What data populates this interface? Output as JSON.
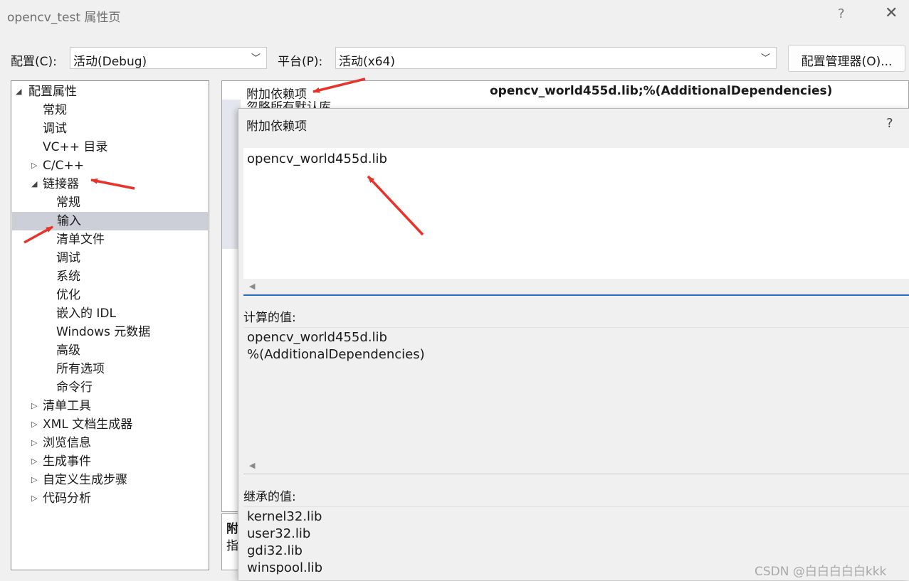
{
  "window": {
    "title": "opencv_test 属性页",
    "help_label": "?",
    "close_label": "✕"
  },
  "config_bar": {
    "config_label": "配置(C):",
    "config_value": "活动(Debug)",
    "platform_label": "平台(P):",
    "platform_value": "活动(x64)",
    "config_manager_button": "配置管理器(O)..."
  },
  "tree": {
    "items": [
      {
        "label": "配置属性",
        "toggle": "◢",
        "level": 0,
        "selected": false
      },
      {
        "label": "常规",
        "toggle": "",
        "level": 1,
        "selected": false
      },
      {
        "label": "调试",
        "toggle": "",
        "level": 1,
        "selected": false
      },
      {
        "label": "VC++ 目录",
        "toggle": "",
        "level": 1,
        "selected": false
      },
      {
        "label": "C/C++",
        "toggle": "▷",
        "level": 1,
        "selected": false
      },
      {
        "label": "链接器",
        "toggle": "◢",
        "level": 1,
        "selected": false
      },
      {
        "label": "常规",
        "toggle": "",
        "level": 2,
        "selected": false
      },
      {
        "label": "输入",
        "toggle": "",
        "level": 2,
        "selected": true
      },
      {
        "label": "清单文件",
        "toggle": "",
        "level": 2,
        "selected": false
      },
      {
        "label": "调试",
        "toggle": "",
        "level": 2,
        "selected": false
      },
      {
        "label": "系统",
        "toggle": "",
        "level": 2,
        "selected": false
      },
      {
        "label": "优化",
        "toggle": "",
        "level": 2,
        "selected": false
      },
      {
        "label": "嵌入的 IDL",
        "toggle": "",
        "level": 2,
        "selected": false
      },
      {
        "label": "Windows 元数据",
        "toggle": "",
        "level": 2,
        "selected": false
      },
      {
        "label": "高级",
        "toggle": "",
        "level": 2,
        "selected": false
      },
      {
        "label": "所有选项",
        "toggle": "",
        "level": 2,
        "selected": false
      },
      {
        "label": "命令行",
        "toggle": "",
        "level": 2,
        "selected": false
      },
      {
        "label": "清单工具",
        "toggle": "▷",
        "level": 1,
        "selected": false
      },
      {
        "label": "XML 文档生成器",
        "toggle": "▷",
        "level": 1,
        "selected": false
      },
      {
        "label": "浏览信息",
        "toggle": "▷",
        "level": 1,
        "selected": false
      },
      {
        "label": "生成事件",
        "toggle": "▷",
        "level": 1,
        "selected": false
      },
      {
        "label": "自定义生成步骤",
        "toggle": "▷",
        "level": 1,
        "selected": false
      },
      {
        "label": "代码分析",
        "toggle": "▷",
        "level": 1,
        "selected": false
      }
    ]
  },
  "property_grid": {
    "row1_name": "附加依赖项",
    "row1_value": "opencv_world455d.lib;%(AdditionalDependencies)",
    "row2_name": "忽略所有默认库",
    "description_title": "附",
    "description_text": "指"
  },
  "popup": {
    "title": "附加依赖项",
    "help_label": "?",
    "edit_text": "opencv_world455d.lib",
    "calc_label": "计算的值:",
    "calc_lines": [
      "opencv_world455d.lib",
      "%(AdditionalDependencies)"
    ],
    "inherited_label": "继承的值:",
    "inherited_lines": [
      "kernel32.lib",
      "user32.lib",
      "gdi32.lib",
      "winspool.lib"
    ]
  },
  "watermark": "CSDN @白白白白白kkk",
  "colors": {
    "annotation_arrow": "#e8322a",
    "selection": "#ccced8",
    "focus_line": "#2c6bc4"
  }
}
